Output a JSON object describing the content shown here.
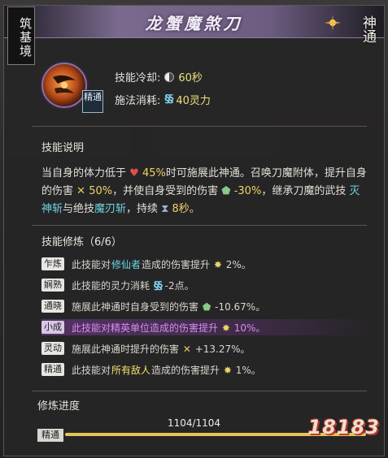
{
  "realm_tag": "筑基境",
  "title": "龙蟹魔煞刀",
  "rank_badge": "神通",
  "skill": {
    "level_label": "精通",
    "cooldown_label": "技能冷却:",
    "cooldown_value": "60秒",
    "mana_label": "施法消耗:",
    "mana_value": "40灵力"
  },
  "description": {
    "heading": "技能说明",
    "p1_a": "当自身的体力低于",
    "p1_hp": "45%",
    "p1_b": "时可施展此神通。召唤刀魔附体，提升自身的伤害",
    "p1_dmg": "50%",
    "p1_c": "，并使自身受到的伤害",
    "p1_def": "-30%",
    "p1_d": "，继承刀魔的武技",
    "p1_skill1": "灭神斩",
    "p1_e": "与绝技",
    "p1_skill2": "魔刃斩",
    "p1_f": "，持续",
    "p1_dur": "8秒。"
  },
  "mods": {
    "heading": "技能修炼（6/6）",
    "rows": [
      {
        "tag": "乍炼",
        "a": "此技能对",
        "hl": "修仙者",
        "b": "造成的伤害提升",
        "val": "2%。"
      },
      {
        "tag": "娴熟",
        "a": "此技能的灵力消耗",
        "hl": "",
        "b": "",
        "val": "-2点。"
      },
      {
        "tag": "通晓",
        "a": "施展此神通时自身受到的伤害",
        "hl": "",
        "b": "",
        "val": "-10.67%。"
      },
      {
        "tag": "小成",
        "a": "此技能对精英单位造成的伤害提升",
        "hl": "",
        "b": "",
        "val": "10%。"
      },
      {
        "tag": "灵动",
        "a": "施展此神通时提升的伤害",
        "hl": "",
        "b": "",
        "val": "+13.27%。"
      },
      {
        "tag": "精通",
        "a": "此技能对",
        "hl": "所有敌人",
        "b": "造成的伤害提升",
        "val": "1%。"
      }
    ]
  },
  "progress": {
    "label": "修炼进度",
    "count": "1104/1104",
    "fraction": 1.0,
    "tag": "精通"
  },
  "watermark": "18183"
}
